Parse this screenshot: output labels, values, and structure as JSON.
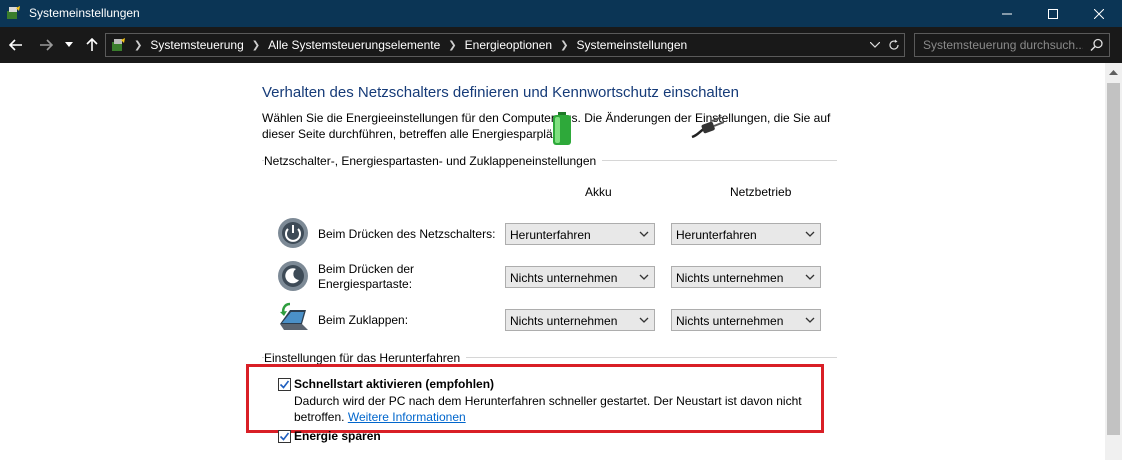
{
  "window": {
    "title": "Systemeinstellungen",
    "minimize_icon": "minimize-icon",
    "maximize_icon": "maximize-icon",
    "close_icon": "close-icon"
  },
  "nav": {
    "back_icon": "arrow-left-icon",
    "forward_icon": "arrow-right-icon",
    "recent_icon": "chevron-down-icon",
    "up_icon": "arrow-up-icon",
    "breadcrumbs": [
      "Systemsteuerung",
      "Alle Systemsteuerungselemente",
      "Energieoptionen",
      "Systemeinstellungen"
    ],
    "search_placeholder": "Systemsteuerung durchsuch..."
  },
  "main": {
    "heading": "Verhalten des Netzschalters definieren und Kennwortschutz einschalten",
    "intro": "Wählen Sie die Energieeinstellungen für den Computer aus. Die Änderungen der Einstellungen, die Sie auf dieser Seite durchführen, betreffen alle Energiesparpläne.",
    "section1_label": "Netzschalter-, Energiespartasten- und Zuklappeneinstellungen",
    "col_battery": "Akku",
    "col_power": "Netzbetrieb",
    "rows": [
      {
        "label": "Beim Drücken des Netzschalters:",
        "battery": "Herunterfahren",
        "power": "Herunterfahren",
        "icon": "power-button-icon"
      },
      {
        "label_line1": "Beim Drücken der",
        "label_line2": "Energiespartaste:",
        "battery": "Nichts unternehmen",
        "power": "Nichts unternehmen",
        "icon": "sleep-button-icon"
      },
      {
        "label": "Beim Zuklappen:",
        "battery": "Nichts unternehmen",
        "power": "Nichts unternehmen",
        "icon": "laptop-lid-icon"
      }
    ],
    "section2_label": "Einstellungen für das Herunterfahren",
    "fast_startup": {
      "checked": true,
      "title": "Schnellstart aktivieren (empfohlen)",
      "desc_prefix": "Dadurch wird der PC nach dem Herunterfahren schneller gestartet. Der Neustart ist davon nicht betroffen.",
      "link": "Weitere Informationen"
    },
    "sleep_option": {
      "checked": true,
      "title": "Energie sparen"
    }
  },
  "colors": {
    "titlebar_bg": "#0b3555",
    "navbar_bg": "#191919",
    "heading": "#163b78",
    "highlight_border": "#d91f26",
    "link": "#0066cc"
  }
}
